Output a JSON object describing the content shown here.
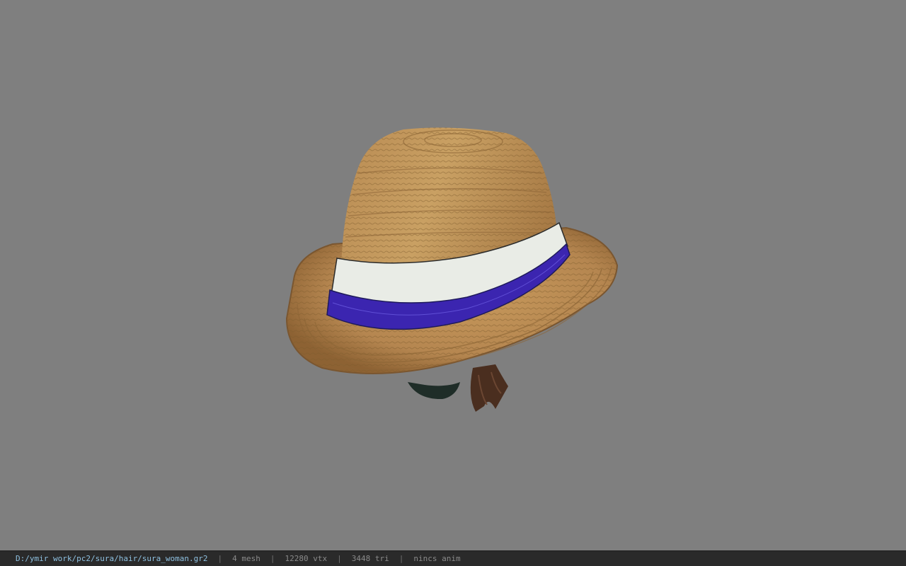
{
  "viewport": {
    "background": "#7f7f7f",
    "model": "straw-fedora-hat"
  },
  "status": {
    "file_path": "D:/ymir work/pc2/sura/hair/sura_woman.gr2",
    "separator": "|",
    "mesh": "4 mesh",
    "vertices": "12280 vtx",
    "triangles": "3448 tri",
    "anim": "nincs anim"
  },
  "colors": {
    "straw": "#c39456",
    "straw_dark": "#8a6334",
    "band_white": "#e9ece6",
    "band_blue": "#3b25b0",
    "hair_brown": "#4a2e1f",
    "dark_green": "#1f2d28",
    "status_path": "#8ec0e0",
    "status_text": "#8a8a8a"
  }
}
